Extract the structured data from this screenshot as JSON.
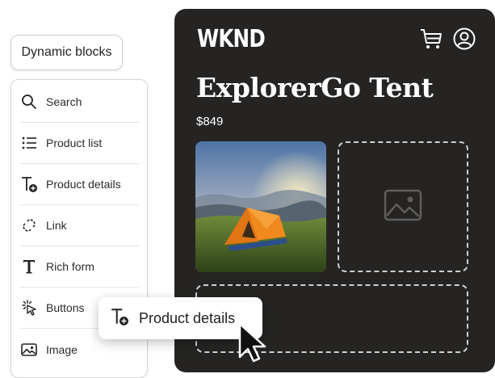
{
  "panel": {
    "title": "Dynamic blocks",
    "items": [
      {
        "label": "Search",
        "icon": "search-icon"
      },
      {
        "label": "Product list",
        "icon": "list-icon"
      },
      {
        "label": "Product details",
        "icon": "text-add-icon"
      },
      {
        "label": "Link",
        "icon": "link-icon"
      },
      {
        "label": "Rich form",
        "icon": "text-icon"
      },
      {
        "label": "Buttons",
        "icon": "button-click-icon"
      },
      {
        "label": "Image",
        "icon": "image-icon"
      }
    ]
  },
  "preview": {
    "brand": "WKND",
    "product_title": "ExplorerGo Tent",
    "price": "$849",
    "background": "#252423"
  },
  "drag": {
    "label": "Product details",
    "icon": "text-add-icon"
  }
}
